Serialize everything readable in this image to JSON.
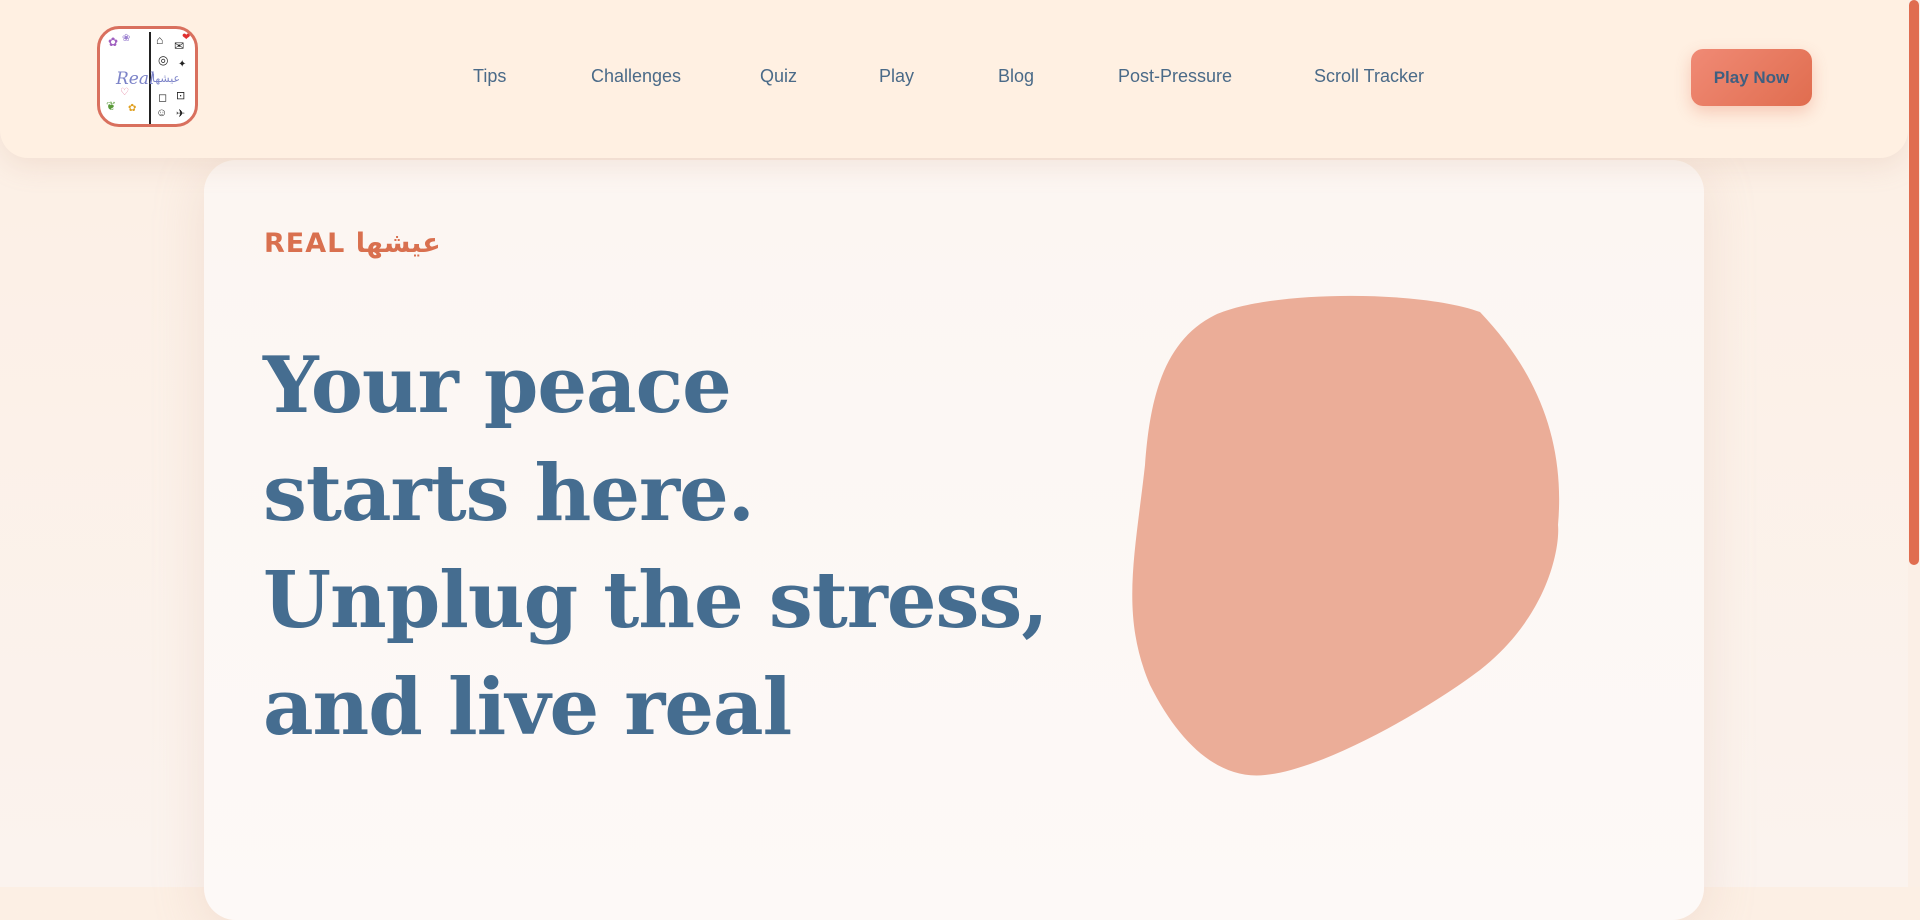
{
  "logo": {
    "text": "Real",
    "arabic": "عيشها"
  },
  "nav": {
    "links": [
      {
        "label": "Tips"
      },
      {
        "label": "Challenges"
      },
      {
        "label": "Quiz"
      },
      {
        "label": "Play"
      },
      {
        "label": "Blog"
      },
      {
        "label": "Post-Pressure"
      },
      {
        "label": "Scroll Tracker"
      }
    ],
    "cta": "Play Now"
  },
  "hero": {
    "brand": "REAL عيشها",
    "lines": [
      "Your peace",
      "starts here.",
      "Unplug the stress,",
      "and live real"
    ]
  },
  "colors": {
    "accent": "#e06d4f",
    "heading": "#456d90",
    "blob": "#ebad98",
    "nav_bg": "#fff0e2"
  },
  "scroll": {
    "position": 0.0
  }
}
